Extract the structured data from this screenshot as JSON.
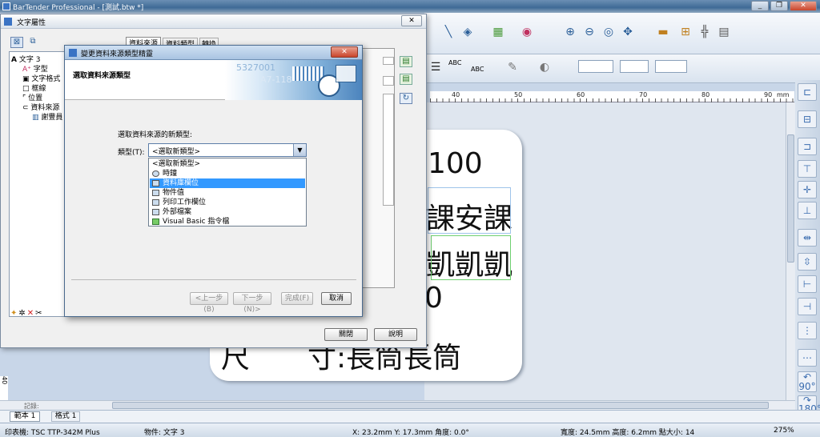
{
  "app": {
    "title": "BarTender Professional - [測試.btw *]"
  },
  "window_controls": {
    "minimize": "_",
    "restore": "❐",
    "close": "✕"
  },
  "label_canvas": {
    "lines": [
      "100",
      "課安課",
      "凱凱凱",
      "0",
      "尺　　寸:長筒長筒"
    ]
  },
  "ruler": {
    "ticks": [
      "40",
      "50",
      "60",
      "70",
      "80",
      "90"
    ],
    "unit": "mm"
  },
  "toolbar2": {
    "text_a": "ABC",
    "text_b": "ABC"
  },
  "text_props": {
    "title": "文字屬性",
    "close": "✕",
    "tabs": [
      "資料來源",
      "資料類型",
      "轉換"
    ],
    "tree": [
      "文字 3",
      "字型",
      "文字格式",
      "框線",
      "位置",
      "資料來源",
      "謝豐員"
    ],
    "close_btn": "關閉",
    "help_btn": "說明"
  },
  "wizard": {
    "title": "變更資料來源類型精靈",
    "close": "✕",
    "heading": "選取資料來源類型",
    "banner_num": "5327001",
    "banner_code": "A7-118",
    "prompt": "選取資料來源的新類型:",
    "type_label": "類型(T):",
    "select_value": "<選取新類型>",
    "options": [
      "<選取新類型>",
      "時鐘",
      "資料庫欄位",
      "物件值",
      "列印工作欄位",
      "外部檔案",
      "Visual Basic 指令檔"
    ],
    "selected_index": 2,
    "back": "<上一步(B)",
    "next": "下一步(N)>",
    "finish": "完成(F)",
    "cancel": "取消"
  },
  "page_tabs": {
    "nav_label": "記錄:",
    "tabs": [
      "範本 1",
      "格式 1"
    ]
  },
  "status": {
    "printer": "印表機: TSC TTP-342M Plus",
    "object": "物件: 文字 3",
    "coords": "X: 23.2mm  Y: 17.3mm  角度: 0.0°",
    "size": "寬度: 24.5mm  高度: 6.2mm  點大小: 14",
    "zoom": "275%"
  },
  "right_strip": {
    "rot1": "90°",
    "rot2": "180°"
  },
  "vruler": {
    "mark": "40"
  }
}
